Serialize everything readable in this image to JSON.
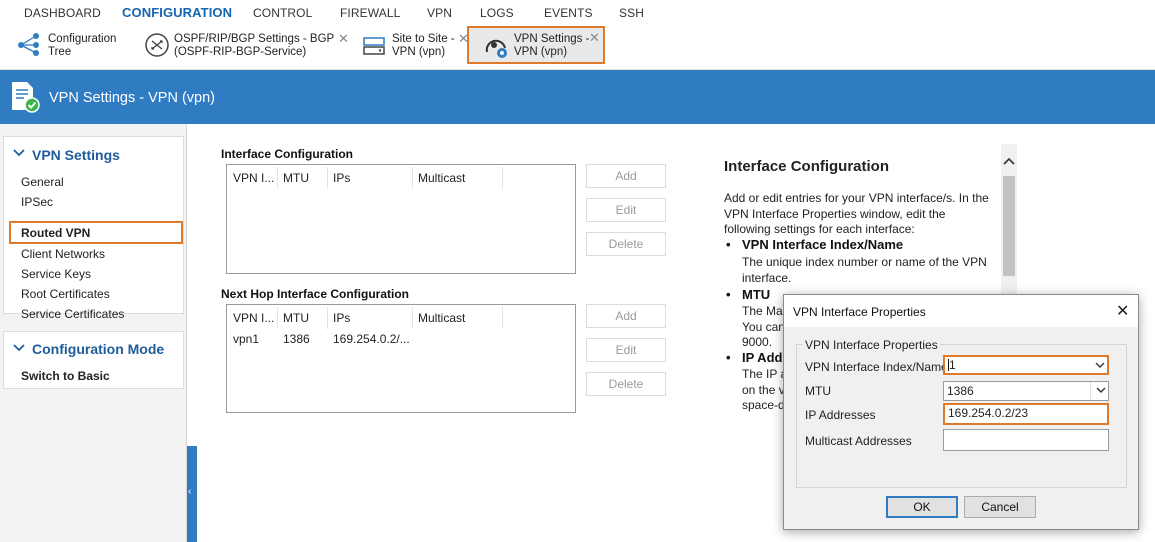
{
  "topmenu": {
    "items": [
      "DASHBOARD",
      "CONFIGURATION",
      "CONTROL",
      "FIREWALL",
      "VPN",
      "LOGS",
      "EVENTS",
      "SSH"
    ],
    "active": "CONFIGURATION"
  },
  "tabs": [
    {
      "label": "Configuration\nTree",
      "icon": "tree-icon",
      "closable": false
    },
    {
      "label": "OSPF/RIP/BGP Settings - BGP\n(OSPF-RIP-BGP-Service)",
      "icon": "router-icon",
      "closable": true
    },
    {
      "label": "Site to Site -\nVPN (vpn)",
      "icon": "network-icon",
      "closable": true
    },
    {
      "label": "VPN Settings -\nVPN (vpn)",
      "icon": "vpn-settings-icon",
      "closable": true,
      "active": true
    }
  ],
  "tab_close": "✕",
  "header": {
    "title": "VPN Settings - VPN (vpn)",
    "color": "#2f7cc3"
  },
  "sidebar": {
    "section1": {
      "title": "VPN Settings",
      "items": [
        "General",
        "IPSec",
        "Routed VPN",
        "Client Networks",
        "Service Keys",
        "Root Certificates",
        "Service Certificates"
      ],
      "selected": "Routed VPN"
    },
    "section2": {
      "title": "Configuration Mode",
      "items": [
        "Switch to Basic"
      ]
    },
    "collapse_glyph": "‹"
  },
  "interface_config": {
    "title": "Interface Configuration",
    "columns": [
      "VPN I...",
      "MTU",
      "IPs",
      "Multicast"
    ],
    "rows": [],
    "buttons": [
      "Add",
      "Edit",
      "Delete"
    ]
  },
  "next_hop_config": {
    "title": "Next Hop Interface Configuration",
    "columns": [
      "VPN I...",
      "MTU",
      "IPs",
      "Multicast"
    ],
    "rows": [
      [
        "vpn1",
        "1386",
        "169.254.0.2/...",
        ""
      ]
    ],
    "buttons": [
      "Add",
      "Edit",
      "Delete"
    ]
  },
  "help": {
    "heading": "Interface Configuration",
    "intro": "Add or edit entries for your VPN interface/s. In the VPN Interface Properties window, edit the following settings for each interface:",
    "bullets": [
      {
        "title": "VPN Interface Index/Name",
        "desc": "The unique index number or name of the VPN interface."
      },
      {
        "title": "MTU",
        "desc": "The Ma\nYou can\n9000."
      },
      {
        "title": "IP Add",
        "desc": "The IP a\non the v\nspace-d"
      }
    ]
  },
  "dialog": {
    "title": "VPN Interface Properties",
    "group_label": "VPN Interface Properties",
    "fields": [
      {
        "label": "VPN Interface Index/Name",
        "value": "1",
        "type": "combo",
        "highlighted": true
      },
      {
        "label": "MTU",
        "value": "1386",
        "type": "combo",
        "highlighted": false
      },
      {
        "label": "IP Addresses",
        "value": "169.254.0.2/23",
        "type": "text",
        "highlighted": true
      },
      {
        "label": "Multicast Addresses",
        "value": "",
        "type": "text",
        "highlighted": false
      }
    ],
    "ok_label": "OK",
    "cancel_label": "Cancel",
    "close_glyph": "✕"
  },
  "colors": {
    "accent": "#2f7cc3",
    "highlight": "#e07a2b"
  }
}
